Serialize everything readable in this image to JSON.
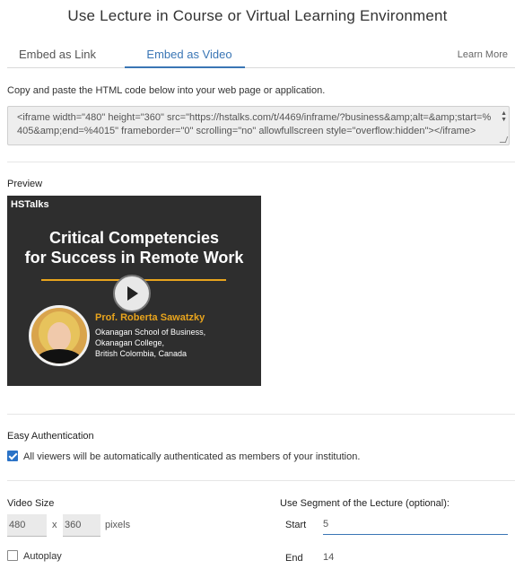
{
  "title": "Use Lecture in Course or Virtual Learning Environment",
  "tabs": {
    "link": "Embed as Link",
    "video": "Embed as Video",
    "learn_more": "Learn More"
  },
  "instructions": "Copy and paste the HTML code below into your web page or application.",
  "code": "<iframe width=\"480\" height=\"360\" src=\"https://hstalks.com/t/4469/inframe/?business&amp;alt=&amp;start=%405&amp;end=%4015\" frameborder=\"0\" scrolling=\"no\" allowfullscreen style=\"overflow:hidden\"></iframe>",
  "preview": {
    "label": "Preview",
    "brand": "HSTalks",
    "title_line1": "Critical Competencies",
    "title_line2": "for Success in Remote Work",
    "presenter": "Prof. Roberta Sawatzky",
    "aff1": "Okanagan School of Business,",
    "aff2": "Okanagan College,",
    "aff3": "British Colombia, Canada"
  },
  "auth": {
    "label": "Easy Authentication",
    "checkbox_text": "All viewers will be automatically authenticated as members of your institution.",
    "checked": true
  },
  "video_size": {
    "label": "Video Size",
    "width": "480",
    "height": "360",
    "x": "x",
    "unit": "pixels"
  },
  "autoplay": {
    "label": "Autoplay",
    "checked": false
  },
  "segment": {
    "label": "Use Segment of the Lecture (optional):",
    "start_label": "Start",
    "start_value": "5",
    "end_label": "End",
    "end_value": "14"
  },
  "colors": {
    "accent": "#3a76b5",
    "checkbox": "#2b73c7",
    "highlight": "#e8a41d"
  }
}
